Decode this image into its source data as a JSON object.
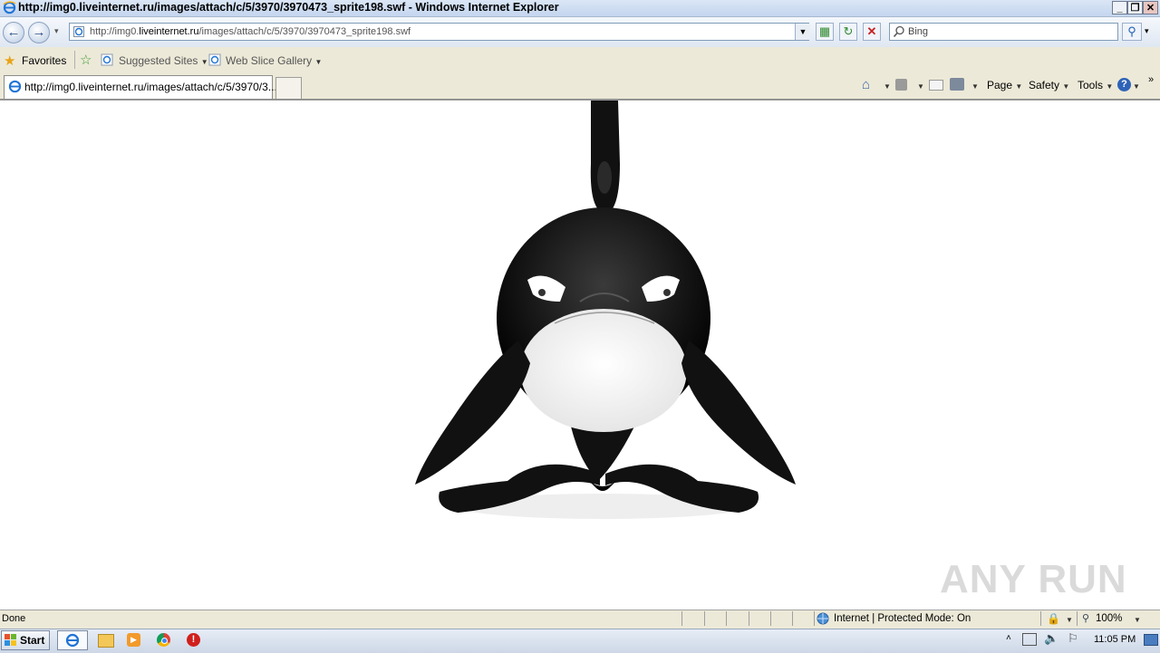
{
  "window": {
    "title": "http://img0.liveinternet.ru/images/attach/c/5/3970/3970473_sprite198.swf - Windows Internet Explorer",
    "controls": {
      "minimize": "_",
      "restore": "❐",
      "close": "✕"
    }
  },
  "navigation": {
    "address_prefix": "http://img0.",
    "address_domain": "liveinternet.ru",
    "address_path": "/images/attach/c/5/3970/3970473_sprite198.swf",
    "search_placeholder": "Bing"
  },
  "favorites_bar": {
    "favorites_label": "Favorites",
    "items": [
      {
        "label": "Suggested Sites"
      },
      {
        "label": "Web Slice Gallery"
      }
    ]
  },
  "tabs": {
    "active_label": "http://img0.liveinternet.ru/images/attach/c/5/3970/3..."
  },
  "command_bar": {
    "page": "Page",
    "safety": "Safety",
    "tools": "Tools"
  },
  "status_bar": {
    "status": "Done",
    "zone": "Internet | Protected Mode: On",
    "zoom": "100%"
  },
  "taskbar": {
    "start_label": "Start",
    "clock": "11:05 PM"
  },
  "watermark": "ANY RUN"
}
